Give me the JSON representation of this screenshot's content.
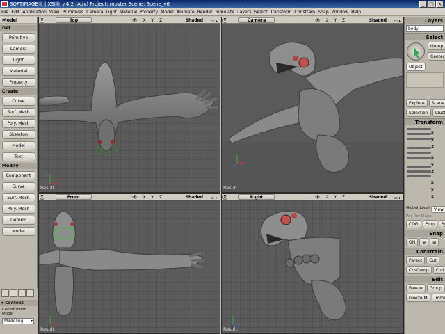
{
  "window": {
    "title": "SOFTIMAGE® | XSI® v.4.2 (Adv) Project: moster    Scene: Scene_v6"
  },
  "menu": [
    "File",
    "Edit",
    "Application",
    "View",
    "Primitives",
    "Camera",
    "Light",
    "Material",
    "Property",
    "Model",
    "Animate",
    "Render",
    "Simulate",
    "Layers",
    "Select",
    "Transform",
    "Constrain",
    "Snap",
    "Window",
    "Help"
  ],
  "left_panel": {
    "header": "Model",
    "get_label": "Get",
    "get_buttons": [
      "Primitive",
      "Camera",
      "Light",
      "Material",
      "Property"
    ],
    "create_label": "Create",
    "create_buttons": [
      "Curve",
      "Surf. Mesh",
      "Poly. Mesh",
      "Skeleton",
      "Model",
      "Text"
    ],
    "modify_label": "Modify",
    "modify_buttons": [
      "Component",
      "Curve",
      "Surf. Mesh",
      "Poly. Mesh",
      "Deform",
      "Model"
    ],
    "context_label": "Context",
    "construction_mode_label": "Construction Mode",
    "construction_mode_value": "Modeling"
  },
  "viewports": {
    "a": {
      "letter": "A",
      "name": "Top",
      "shading": "Shaded",
      "icons": "👁 X Y Z",
      "result": "Result"
    },
    "b": {
      "letter": "B",
      "name": "Camera",
      "shading": "Shaded",
      "icons": "👁 X Y Z",
      "result": "Result"
    },
    "c": {
      "letter": "C",
      "name": "Front",
      "shading": "Shaded",
      "icons": "👁 X Y Z",
      "result": "Result"
    },
    "d": {
      "letter": "D",
      "name": "Right",
      "shading": "Shaded",
      "icons": "👁 X Y Z",
      "result": "Result"
    }
  },
  "right_panel": {
    "layers_label": "Layers",
    "layer_value": "body",
    "select_label": "Select",
    "group_label": "Group",
    "center_label": "Center",
    "object_label": "Object",
    "explore_label": "Explore",
    "scene_label": "Scene",
    "selection_label": "Selection",
    "clusters_label": "Clusters",
    "transform_label": "Transform",
    "global_label": "Global",
    "local_label": "Local",
    "view_label": "View",
    "par_label": "Par",
    "ref_label": "Ref",
    "plane_label": "Plane",
    "cog_label": "COG",
    "prop_label": "Prop",
    "sym_label": "Sym",
    "snap_label": "Snap",
    "on_label": "ON",
    "constrain_label": "Constrain",
    "parent_label": "Parent",
    "cut_label": "Cut",
    "cnscomp_label": "CnsComp",
    "childcomp_label": "ChildComp",
    "edit_label": "Edit",
    "freeze_label": "Freeze",
    "freeze_m_label": "Freeze M",
    "immed_label": "Immed"
  }
}
